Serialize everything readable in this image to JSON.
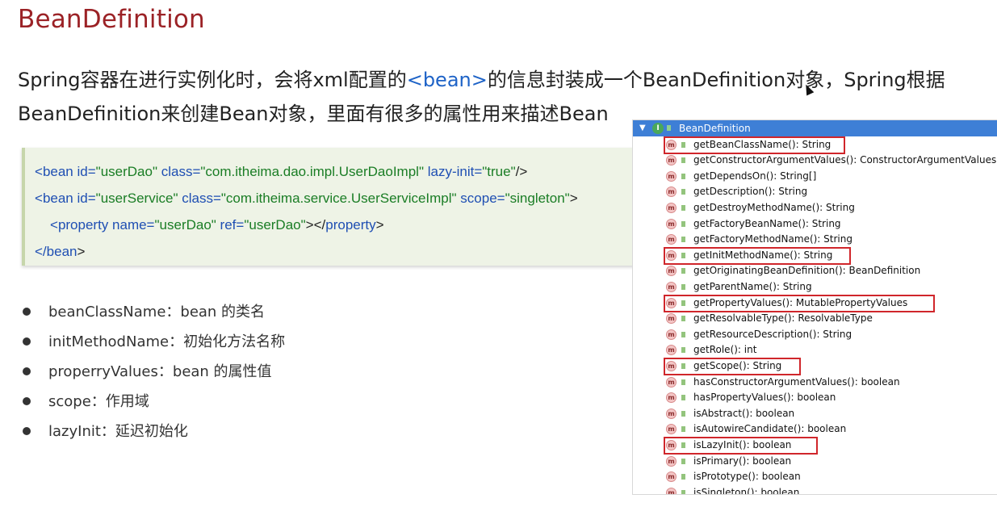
{
  "slide": {
    "title": "BeanDefinition",
    "para_line1_pre": "Spring容器在进行实例化时，会将xml配置的",
    "para_line1_tag": "<bean>",
    "para_line1_post": "的信息封装成一个BeanDefinition对象，Spring根据",
    "para_line2": "BeanDefinition来创建Bean对象，里面有很多的属性用来描述Bean"
  },
  "code": {
    "l1_open": "<",
    "l1_tag": "bean",
    "l1_a1": " id=",
    "l1_v1": "\"userDao\"",
    "l1_a2": " class=",
    "l1_v2": "\"com.itheima.dao.impl.UserDaoImpl\"",
    "l1_a3": " lazy-init=",
    "l1_v3": "\"true\"",
    "l1_close": "/>",
    "l2_open": "<",
    "l2_tag": "bean",
    "l2_a1": " id=",
    "l2_v1": "\"userService\"",
    "l2_a2": " class=",
    "l2_v2": "\"com.itheima.service.UserServiceImpl\"",
    "l2_a3": " scope=",
    "l2_v3": "\"singleton\"",
    "l2_close": ">",
    "l3_open": "<",
    "l3_tag": "property",
    "l3_a1": " name=",
    "l3_v1": "\"userDao\"",
    "l3_a2": " ref=",
    "l3_v2": "\"userDao\"",
    "l3_mid": "></",
    "l3_tag2": "property",
    "l3_close": ">",
    "l4_open": "</",
    "l4_tag": "bean",
    "l4_close": ">"
  },
  "bullets": [
    {
      "label": "beanClassName：bean 的类名"
    },
    {
      "label": "initMethodName：初始化方法名称"
    },
    {
      "label": "properryValues：bean 的属性值"
    },
    {
      "label": "scope：作用域"
    },
    {
      "label": "lazyInit：延迟初始化"
    }
  ],
  "panel": {
    "header_label": "BeanDefinition",
    "header_icon": "interface-icon",
    "method_icon_letter": "m",
    "highlight_color": "#d0262b",
    "methods": [
      {
        "label": "getBeanClassName(): String",
        "highlighted": true
      },
      {
        "label": "getConstructorArgumentValues(): ConstructorArgumentValues",
        "highlighted": false
      },
      {
        "label": "getDependsOn(): String[]",
        "highlighted": false
      },
      {
        "label": "getDescription(): String",
        "highlighted": false
      },
      {
        "label": "getDestroyMethodName(): String",
        "highlighted": false
      },
      {
        "label": "getFactoryBeanName(): String",
        "highlighted": false
      },
      {
        "label": "getFactoryMethodName(): String",
        "highlighted": false
      },
      {
        "label": "getInitMethodName(): String",
        "highlighted": true
      },
      {
        "label": "getOriginatingBeanDefinition(): BeanDefinition",
        "highlighted": false
      },
      {
        "label": "getParentName(): String",
        "highlighted": false
      },
      {
        "label": "getPropertyValues(): MutablePropertyValues",
        "highlighted": true
      },
      {
        "label": "getResolvableType(): ResolvableType",
        "highlighted": false
      },
      {
        "label": "getResourceDescription(): String",
        "highlighted": false
      },
      {
        "label": "getRole(): int",
        "highlighted": false
      },
      {
        "label": "getScope(): String",
        "highlighted": true
      },
      {
        "label": "hasConstructorArgumentValues(): boolean",
        "highlighted": false
      },
      {
        "label": "hasPropertyValues(): boolean",
        "highlighted": false
      },
      {
        "label": "isAbstract(): boolean",
        "highlighted": false
      },
      {
        "label": "isAutowireCandidate(): boolean",
        "highlighted": false
      },
      {
        "label": "isLazyInit(): boolean",
        "highlighted": true
      },
      {
        "label": "isPrimary(): boolean",
        "highlighted": false
      },
      {
        "label": "isPrototype(): boolean",
        "highlighted": false
      },
      {
        "label": "isSingleton(): boolean",
        "highlighted": false
      }
    ]
  }
}
